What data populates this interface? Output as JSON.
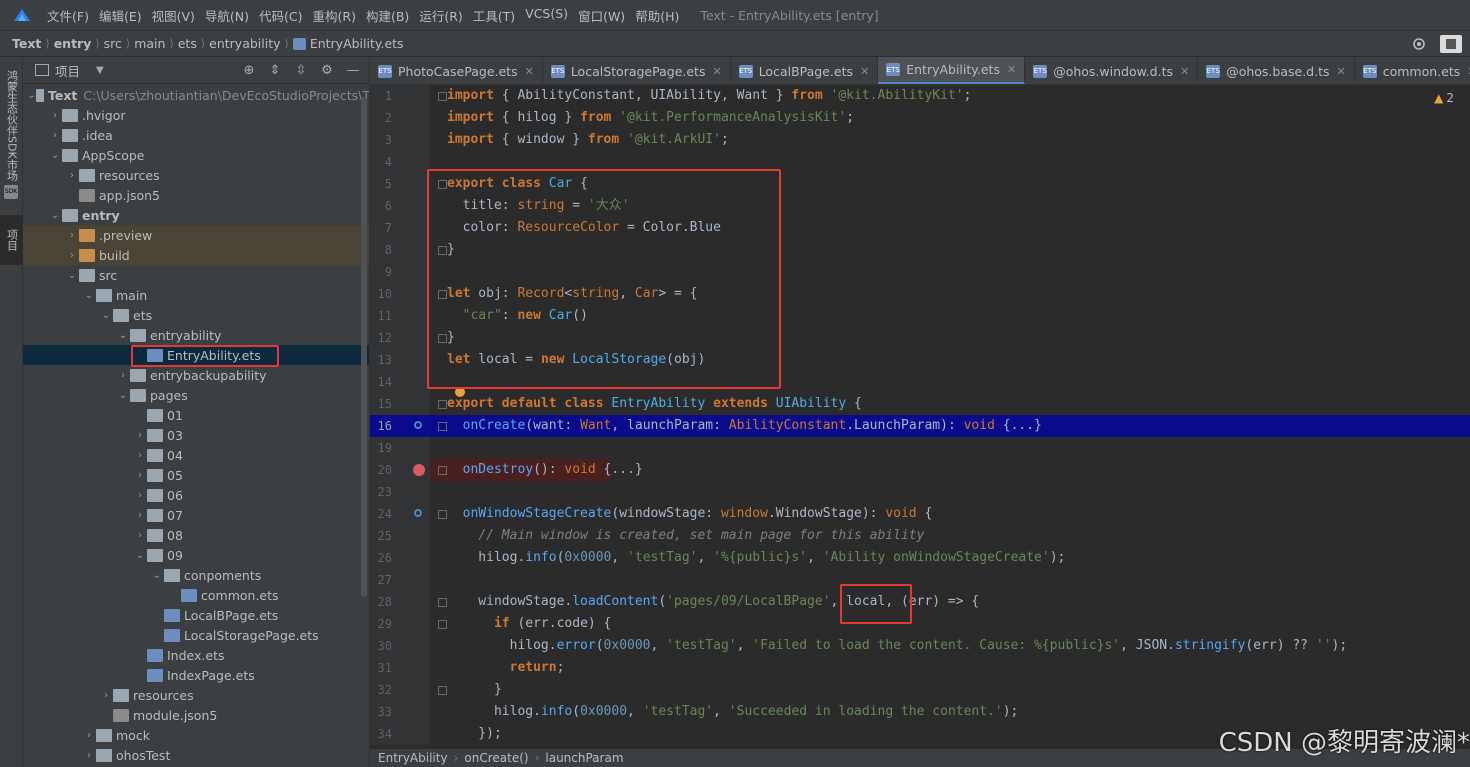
{
  "window": {
    "title": "Text - EntryAbility.ets [entry]",
    "menu": [
      "文件(F)",
      "编辑(E)",
      "视图(V)",
      "导航(N)",
      "代码(C)",
      "重构(R)",
      "构建(B)",
      "运行(R)",
      "工具(T)",
      "VCS(S)",
      "窗口(W)",
      "帮助(H)"
    ]
  },
  "breadcrumb": [
    "Text",
    "entry",
    "src",
    "main",
    "ets",
    "entryability",
    "EntryAbility.ets"
  ],
  "left_stripe": {
    "tab1": "鸿蒙生态伙伴SDK市场",
    "tab2": "项目"
  },
  "project_panel": {
    "title": "项目",
    "root_label": "Text",
    "root_path": "C:\\Users\\zhoutiantian\\DevEcoStudioProjects\\T",
    "tree": [
      {
        "label": "Text",
        "depth": 0,
        "open": true,
        "type": "folder",
        "bold": true
      },
      {
        "label": ".hvigor",
        "depth": 1,
        "open": false,
        "type": "folder"
      },
      {
        "label": ".idea",
        "depth": 1,
        "open": false,
        "type": "folder"
      },
      {
        "label": "AppScope",
        "depth": 1,
        "open": true,
        "type": "folder"
      },
      {
        "label": "resources",
        "depth": 2,
        "open": false,
        "type": "folder"
      },
      {
        "label": "app.json5",
        "depth": 2,
        "type": "json"
      },
      {
        "label": "entry",
        "depth": 1,
        "open": true,
        "type": "folder",
        "bold": true
      },
      {
        "label": ".preview",
        "depth": 2,
        "open": false,
        "type": "folder-orange",
        "excluded": true
      },
      {
        "label": "build",
        "depth": 2,
        "open": false,
        "type": "folder-orange",
        "excluded": true
      },
      {
        "label": "src",
        "depth": 2,
        "open": true,
        "type": "folder"
      },
      {
        "label": "main",
        "depth": 3,
        "open": true,
        "type": "folder"
      },
      {
        "label": "ets",
        "depth": 4,
        "open": true,
        "type": "folder"
      },
      {
        "label": "entryability",
        "depth": 5,
        "open": true,
        "type": "folder"
      },
      {
        "label": "EntryAbility.ets",
        "depth": 6,
        "type": "file",
        "selected": true
      },
      {
        "label": "entrybackupability",
        "depth": 5,
        "open": false,
        "type": "folder"
      },
      {
        "label": "pages",
        "depth": 5,
        "open": true,
        "type": "folder"
      },
      {
        "label": "01",
        "depth": 6,
        "type": "folder"
      },
      {
        "label": "03",
        "depth": 6,
        "open": false,
        "type": "folder"
      },
      {
        "label": "04",
        "depth": 6,
        "open": false,
        "type": "folder"
      },
      {
        "label": "05",
        "depth": 6,
        "open": false,
        "type": "folder"
      },
      {
        "label": "06",
        "depth": 6,
        "open": false,
        "type": "folder"
      },
      {
        "label": "07",
        "depth": 6,
        "open": false,
        "type": "folder"
      },
      {
        "label": "08",
        "depth": 6,
        "open": false,
        "type": "folder"
      },
      {
        "label": "09",
        "depth": 6,
        "open": true,
        "type": "folder"
      },
      {
        "label": "conpoments",
        "depth": 7,
        "open": true,
        "type": "folder"
      },
      {
        "label": "common.ets",
        "depth": 8,
        "type": "file"
      },
      {
        "label": "LocalBPage.ets",
        "depth": 7,
        "type": "file"
      },
      {
        "label": "LocalStoragePage.ets",
        "depth": 7,
        "type": "file"
      },
      {
        "label": "Index.ets",
        "depth": 6,
        "type": "file"
      },
      {
        "label": "IndexPage.ets",
        "depth": 6,
        "type": "file"
      },
      {
        "label": "resources",
        "depth": 4,
        "open": false,
        "type": "folder"
      },
      {
        "label": "module.json5",
        "depth": 4,
        "type": "json"
      },
      {
        "label": "mock",
        "depth": 3,
        "open": false,
        "type": "folder"
      },
      {
        "label": "ohosTest",
        "depth": 3,
        "open": false,
        "type": "folder"
      }
    ]
  },
  "editor_tabs": [
    {
      "label": "PhotoCasePage.ets",
      "active": false
    },
    {
      "label": "LocalStoragePage.ets",
      "active": false
    },
    {
      "label": "LocalBPage.ets",
      "active": false
    },
    {
      "label": "EntryAbility.ets",
      "active": true
    },
    {
      "label": "@ohos.window.d.ts",
      "active": false
    },
    {
      "label": "@ohos.base.d.ts",
      "active": false
    },
    {
      "label": "common.ets",
      "active": false
    }
  ],
  "inspections": {
    "warnings": "2"
  },
  "code_lines": [
    {
      "n": "1",
      "html": "<span class='kw'>import</span> { AbilityConstant, UIAbility, Want } <span class='kw'>from</span> <span class='str'>'@kit.AbilityKit'</span>;"
    },
    {
      "n": "2",
      "html": "<span class='kw'>import</span> { hilog } <span class='kw'>from</span> <span class='str'>'@kit.PerformanceAnalysisKit'</span>;"
    },
    {
      "n": "3",
      "html": "<span class='kw'>import</span> { window } <span class='kw'>from</span> <span class='str'>'@kit.ArkUI'</span>;"
    },
    {
      "n": "4",
      "html": ""
    },
    {
      "n": "5",
      "html": "<span class='kw'>export class</span> <span class='typ'>Car</span> {"
    },
    {
      "n": "6",
      "html": "  title: <span class='kw2'>string</span> = <span class='str'>'大众'</span>"
    },
    {
      "n": "7",
      "html": "  color: <span class='kw2'>ResourceColor</span> = Color.Blue"
    },
    {
      "n": "8",
      "html": "}"
    },
    {
      "n": "9",
      "html": ""
    },
    {
      "n": "10",
      "html": "<span class='kw'>let</span> obj: <span class='kw2'>Record</span>&lt;<span class='kw2'>string</span>, <span class='kw2'>Car</span>&gt; = {"
    },
    {
      "n": "11",
      "html": "  <span class='str'>\"car\"</span>: <span class='kw'>new</span> <span class='typ'>Car</span>()"
    },
    {
      "n": "12",
      "html": "}"
    },
    {
      "n": "13",
      "html": "<span class='kw'>let</span> local = <span class='kw'>new</span> <span class='typ'>LocalStorage</span>(obj)"
    },
    {
      "n": "14",
      "html": ""
    },
    {
      "n": "15",
      "html": "<span class='kw'>export default class</span> <span class='typ'>EntryAbility</span> <span class='kw'>extends</span> <span class='typ'>UIAbility</span> {"
    },
    {
      "n": "16",
      "html": "  <span class='mth'>onCreate</span>(want: <span class='kw2'>Want</span>, launchParam: <span class='kw2'>AbilityConstant</span>.LaunchParam): <span class='kw2'>void</span> {...}"
    },
    {
      "n": "19",
      "html": ""
    },
    {
      "n": "20",
      "html": "  <span class='mth'>onDestroy</span>(): <span class='kw2'>void</span> {...}"
    },
    {
      "n": "23",
      "html": ""
    },
    {
      "n": "24",
      "html": "  <span class='mth'>onWindowStageCreate</span>(windowStage: <span class='kw2'>window</span>.WindowStage): <span class='kw2'>void</span> {"
    },
    {
      "n": "25",
      "html": "    <span class='cm'>// Main window is created, set main page for this ability</span>"
    },
    {
      "n": "26",
      "html": "    hilog.<span class='mth'>info</span>(<span class='num'>0x0000</span>, <span class='str'>'testTag'</span>, <span class='str'>'%{public}s'</span>, <span class='str'>'Ability onWindowStageCreate'</span>);"
    },
    {
      "n": "27",
      "html": ""
    },
    {
      "n": "28",
      "html": "    windowStage.<span class='mth'>loadContent</span>(<span class='str'>'pages/09/LocalBPage'</span>, local, (err) =&gt; {"
    },
    {
      "n": "29",
      "html": "      <span class='kw'>if</span> (err.code) {"
    },
    {
      "n": "30",
      "html": "        hilog.<span class='mth'>error</span>(<span class='num'>0x0000</span>, <span class='str'>'testTag'</span>, <span class='str'>'Failed to load the content. Cause: %{public}s'</span>, JSON.<span class='mth'>stringify</span>(err) ?? <span class='str'>''</span>);"
    },
    {
      "n": "31",
      "html": "        <span class='kw'>return</span>;"
    },
    {
      "n": "32",
      "html": "      }"
    },
    {
      "n": "33",
      "html": "      hilog.<span class='mth'>info</span>(<span class='num'>0x0000</span>, <span class='str'>'testTag'</span>, <span class='str'>'Succeeded in loading the content.'</span>);"
    },
    {
      "n": "34",
      "html": "    });"
    }
  ],
  "status_breadcrumb": [
    "EntryAbility",
    "onCreate()",
    "launchParam"
  ],
  "watermark": "CSDN @黎明寄波澜*"
}
